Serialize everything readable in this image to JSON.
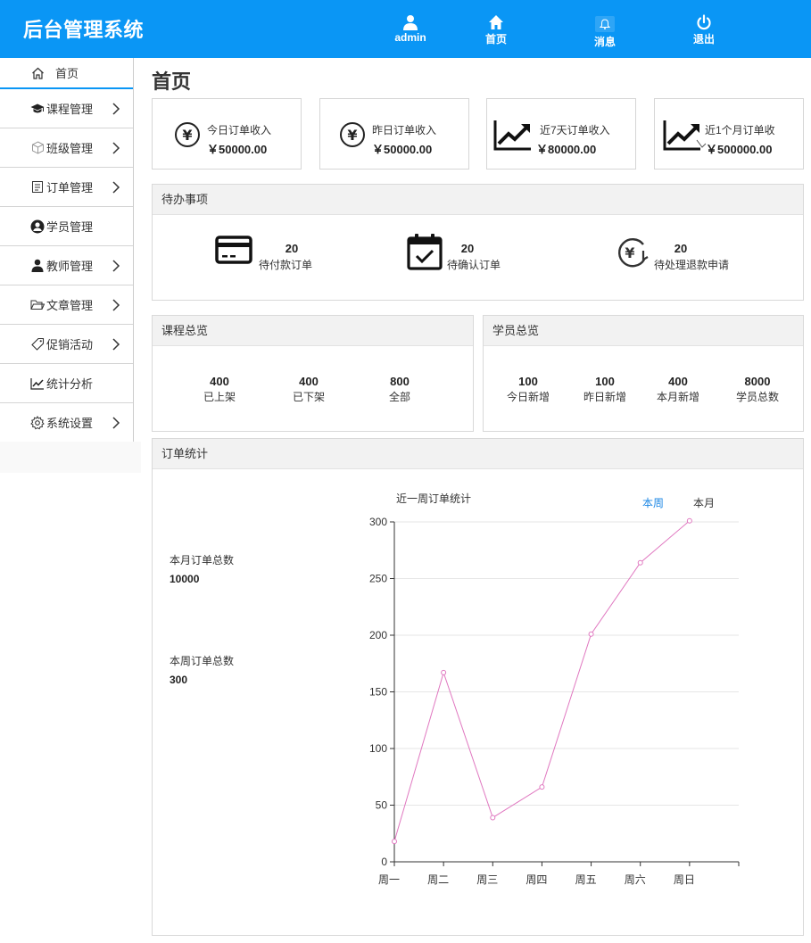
{
  "header": {
    "brand": "后台管理系统",
    "nav": [
      {
        "label": "admin",
        "icon": "user-icon"
      },
      {
        "label": "首页",
        "icon": "home-icon"
      },
      {
        "label": "消息",
        "icon": "bell-icon"
      },
      {
        "label": "退出",
        "icon": "power-icon"
      }
    ]
  },
  "sidebar": {
    "items": [
      {
        "label": "首页",
        "icon": "home-icon",
        "has_arrow": false
      },
      {
        "label": "课程管理",
        "icon": "graduation-cap-icon",
        "has_arrow": true
      },
      {
        "label": "班级管理",
        "icon": "cube-icon",
        "has_arrow": true
      },
      {
        "label": "订单管理",
        "icon": "clipboard-icon",
        "has_arrow": true
      },
      {
        "label": "学员管理",
        "icon": "user-circle-icon",
        "has_arrow": false
      },
      {
        "label": "教师管理",
        "icon": "teacher-icon",
        "has_arrow": true
      },
      {
        "label": "文章管理",
        "icon": "folder-icon",
        "has_arrow": true
      },
      {
        "label": "促销活动",
        "icon": "tag-icon",
        "has_arrow": true
      },
      {
        "label": "统计分析",
        "icon": "line-chart-icon",
        "has_arrow": false
      },
      {
        "label": "系统设置",
        "icon": "gear-icon",
        "has_arrow": true
      }
    ]
  },
  "page_title": "首页",
  "stats": [
    {
      "label": "今日订单收入",
      "value": "￥50000.00",
      "icon": "yen-circle-icon"
    },
    {
      "label": "昨日订单收入",
      "value": "￥50000.00",
      "icon": "yen-circle-icon"
    },
    {
      "label": "近7天订单收入",
      "value": "￥80000.00",
      "icon": "trend-up-icon"
    },
    {
      "label": "近1个月订单收",
      "value": "￥500000.00",
      "icon": "trend-up-icon"
    }
  ],
  "todo": {
    "title": "待办事项",
    "items": [
      {
        "count": "20",
        "label": "待付款订单",
        "icon": "credit-card-icon"
      },
      {
        "count": "20",
        "label": "待确认订单",
        "icon": "calendar-check-icon"
      },
      {
        "count": "20",
        "label": "待处理退款申请",
        "icon": "yen-refund-icon"
      }
    ]
  },
  "course_overview": {
    "title": "课程总览",
    "items": [
      {
        "value": "400",
        "label": "已上架"
      },
      {
        "value": "400",
        "label": "已下架"
      },
      {
        "value": "800",
        "label": "全部"
      }
    ]
  },
  "student_overview": {
    "title": "学员总览",
    "items": [
      {
        "value": "100",
        "label": "今日新增"
      },
      {
        "value": "100",
        "label": "昨日新增"
      },
      {
        "value": "400",
        "label": "本月新增"
      },
      {
        "value": "8000",
        "label": "学员总数"
      }
    ]
  },
  "order_stats": {
    "title": "订单统计",
    "month_label": "本月订单总数",
    "month_value": "10000",
    "week_label": "本周订单总数",
    "week_value": "300",
    "tab_week": "本周",
    "tab_month": "本月"
  },
  "chart_data": {
    "type": "line",
    "title": "近一周订单统计",
    "categories": [
      "周一",
      "周二",
      "周三",
      "周四",
      "周五",
      "周六",
      "周日"
    ],
    "series": [
      {
        "values": [
          18,
          167,
          39,
          66,
          201,
          264,
          301
        ]
      }
    ],
    "ylim": [
      0,
      300
    ],
    "yticks": [
      "0",
      "50",
      "100",
      "150",
      "200",
      "250",
      "300"
    ],
    "grid": true,
    "color": "#e078c0"
  }
}
